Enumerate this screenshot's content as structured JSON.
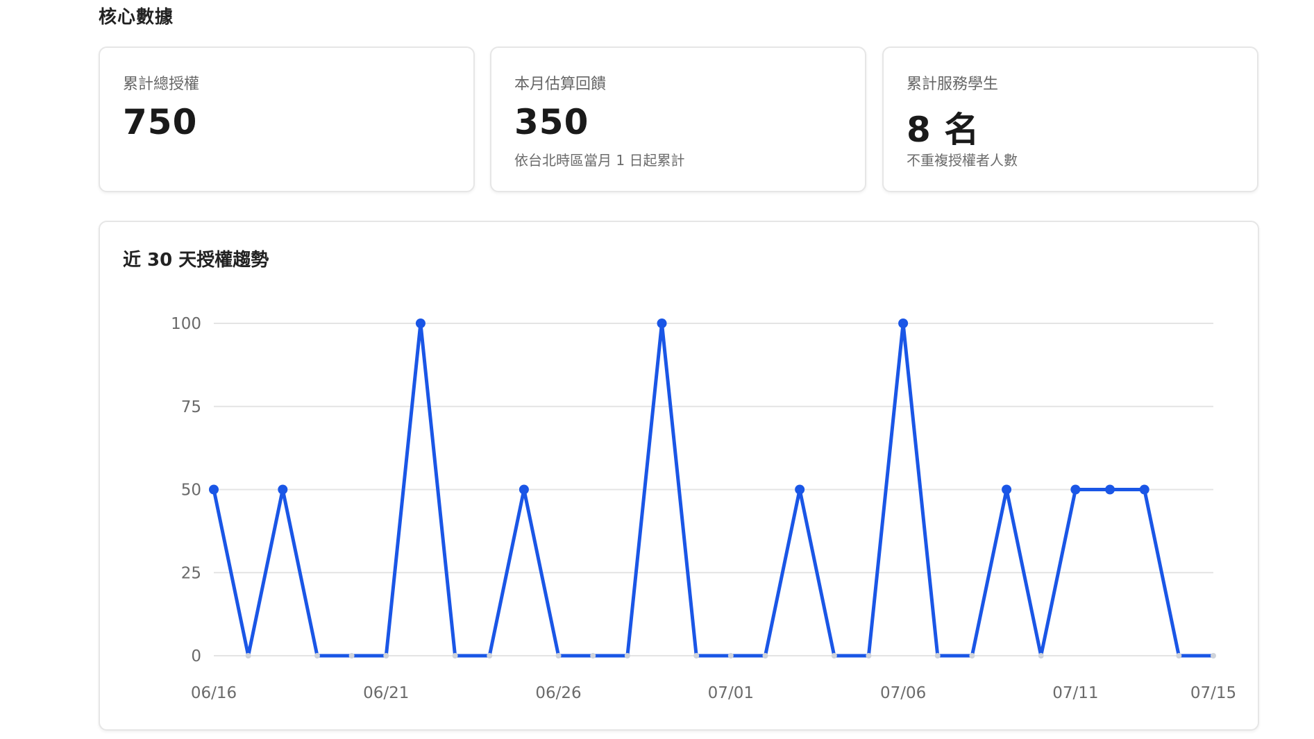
{
  "section": {
    "title": "核心數據"
  },
  "stats": [
    {
      "label": "累計總授權",
      "value": "750",
      "note": ""
    },
    {
      "label": "本月估算回饋",
      "value": "350",
      "note": "依台北時區當月 1 日起累計"
    },
    {
      "label": "累計服務學生",
      "value": "8 名",
      "note": "不重複授權者人數"
    }
  ],
  "chart": {
    "title": "近 30 天授權趨勢"
  },
  "colors": {
    "line": "#1a56e6",
    "zero_point": "#cfd3da",
    "grid": "#e4e4e4"
  },
  "chart_data": {
    "type": "line",
    "title": "近 30 天授權趨勢",
    "xlabel": "",
    "ylabel": "",
    "ylim": [
      0,
      100
    ],
    "yticks": [
      0,
      25,
      50,
      75,
      100
    ],
    "grid": true,
    "x": [
      "06/16",
      "06/17",
      "06/18",
      "06/19",
      "06/20",
      "06/21",
      "06/22",
      "06/23",
      "06/24",
      "06/25",
      "06/26",
      "06/27",
      "06/28",
      "06/29",
      "06/30",
      "07/01",
      "07/02",
      "07/03",
      "07/04",
      "07/05",
      "07/06",
      "07/07",
      "07/08",
      "07/09",
      "07/10",
      "07/11",
      "07/12",
      "07/13",
      "07/14",
      "07/15"
    ],
    "xtick_labels": [
      "06/16",
      "06/21",
      "06/26",
      "07/01",
      "07/06",
      "07/11",
      "07/15"
    ],
    "series": [
      {
        "values": [
          50,
          0,
          50,
          0,
          0,
          0,
          100,
          0,
          0,
          50,
          0,
          0,
          0,
          100,
          0,
          0,
          0,
          50,
          0,
          0,
          100,
          0,
          0,
          50,
          0,
          50,
          50,
          50,
          0,
          0
        ]
      }
    ]
  }
}
